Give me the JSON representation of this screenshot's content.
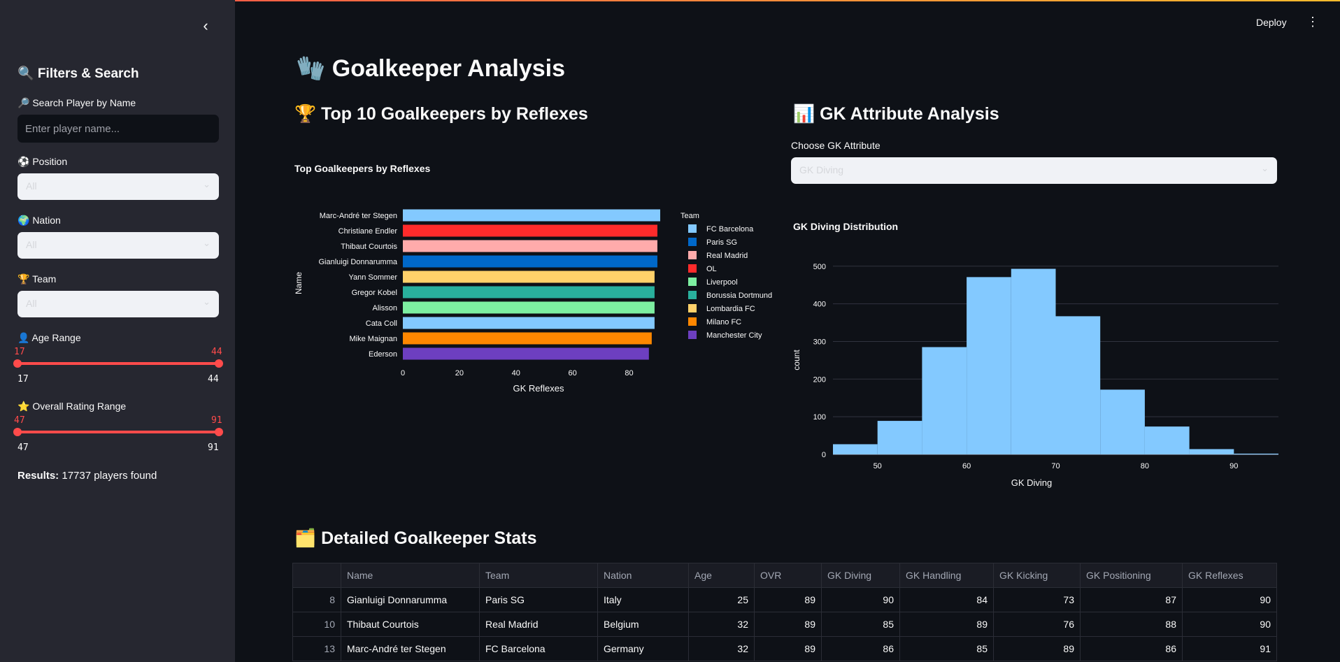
{
  "app": {
    "deploy_label": "Deploy"
  },
  "sidebar": {
    "title": "🔍 Filters & Search",
    "search": {
      "label": "🔎 Search Player by Name",
      "placeholder": "Enter player name...",
      "value": ""
    },
    "position": {
      "label": "⚽ Position",
      "value": "All"
    },
    "nation": {
      "label": "🌍 Nation",
      "value": "All"
    },
    "team": {
      "label": "🏆 Team",
      "value": "All"
    },
    "age_range": {
      "label": "👤 Age Range",
      "low": 17,
      "high": 44,
      "min": 17,
      "max": 44
    },
    "rating_range": {
      "label": "⭐ Overall Rating Range",
      "low": 47,
      "high": 91,
      "min": 47,
      "max": 91
    },
    "results": {
      "label": "Results:",
      "text": "17737 players found"
    }
  },
  "main": {
    "title": "🧤 Goalkeeper Analysis",
    "top10_heading": "🏆 Top 10 Goalkeepers by Reflexes",
    "attr_heading": "📊 GK Attribute Analysis",
    "attr_select": {
      "label": "Choose GK Attribute",
      "value": "GK Diving"
    },
    "table_heading": "🗂️ Detailed Goalkeeper Stats"
  },
  "chart_data": [
    {
      "type": "bar",
      "orientation": "horizontal",
      "title": "Top Goalkeepers by Reflexes",
      "xlabel": "GK Reflexes",
      "ylabel": "Name",
      "xlim": [
        0,
        91
      ],
      "xticks": [
        0,
        20,
        40,
        60,
        80
      ],
      "legend_title": "Team",
      "legend_position": "right",
      "legend": [
        {
          "name": "FC Barcelona",
          "color": "#83c9ff"
        },
        {
          "name": "Paris SG",
          "color": "#0068c9"
        },
        {
          "name": "Real Madrid",
          "color": "#ffabab"
        },
        {
          "name": "OL",
          "color": "#ff2b2b"
        },
        {
          "name": "Liverpool",
          "color": "#7defa1"
        },
        {
          "name": "Borussia Dortmund",
          "color": "#29b09d"
        },
        {
          "name": "Lombardia FC",
          "color": "#ffd16a"
        },
        {
          "name": "Milano FC",
          "color": "#ff8700"
        },
        {
          "name": "Manchester City",
          "color": "#6d3fc0"
        }
      ],
      "bars": [
        {
          "name": "Marc-André ter Stegen",
          "team": "FC Barcelona",
          "value": 91
        },
        {
          "name": "Christiane Endler",
          "team": "OL",
          "value": 90
        },
        {
          "name": "Thibaut Courtois",
          "team": "Real Madrid",
          "value": 90
        },
        {
          "name": "Gianluigi Donnarumma",
          "team": "Paris SG",
          "value": 90
        },
        {
          "name": "Yann Sommer",
          "team": "Lombardia FC",
          "value": 89
        },
        {
          "name": "Gregor Kobel",
          "team": "Borussia Dortmund",
          "value": 89
        },
        {
          "name": "Alisson",
          "team": "Liverpool",
          "value": 89
        },
        {
          "name": "Cata Coll",
          "team": "FC Barcelona",
          "value": 89
        },
        {
          "name": "Mike Maignan",
          "team": "Milano FC",
          "value": 88
        },
        {
          "name": "Ederson",
          "team": "Manchester City",
          "value": 87
        }
      ]
    },
    {
      "type": "bar",
      "subtype": "histogram",
      "title": "GK Diving Distribution",
      "xlabel": "GK Diving",
      "ylabel": "count",
      "xlim": [
        45,
        95
      ],
      "ylim": [
        0,
        520
      ],
      "xticks": [
        50,
        60,
        70,
        80,
        90
      ],
      "yticks": [
        0,
        100,
        200,
        300,
        400,
        500
      ],
      "grid": true,
      "color": "#83c9ff",
      "bins": [
        {
          "x0": 45,
          "x1": 50,
          "count": 27
        },
        {
          "x0": 50,
          "x1": 55,
          "count": 89
        },
        {
          "x0": 55,
          "x1": 60,
          "count": 285
        },
        {
          "x0": 60,
          "x1": 65,
          "count": 471
        },
        {
          "x0": 65,
          "x1": 70,
          "count": 493
        },
        {
          "x0": 70,
          "x1": 75,
          "count": 367
        },
        {
          "x0": 75,
          "x1": 80,
          "count": 172
        },
        {
          "x0": 80,
          "x1": 85,
          "count": 74
        },
        {
          "x0": 85,
          "x1": 90,
          "count": 14
        },
        {
          "x0": 90,
          "x1": 95,
          "count": 2
        }
      ]
    }
  ],
  "table": {
    "columns": [
      "",
      "Name",
      "Team",
      "Nation",
      "Age",
      "OVR",
      "GK Diving",
      "GK Handling",
      "GK Kicking",
      "GK Positioning",
      "GK Reflexes"
    ],
    "rows": [
      [
        "8",
        "Gianluigi Donnarumma",
        "Paris SG",
        "Italy",
        "25",
        "89",
        "90",
        "84",
        "73",
        "87",
        "90"
      ],
      [
        "10",
        "Thibaut Courtois",
        "Real Madrid",
        "Belgium",
        "32",
        "89",
        "85",
        "89",
        "76",
        "88",
        "90"
      ],
      [
        "13",
        "Marc-André ter Stegen",
        "FC Barcelona",
        "Germany",
        "32",
        "89",
        "86",
        "85",
        "89",
        "86",
        "91"
      ]
    ]
  }
}
